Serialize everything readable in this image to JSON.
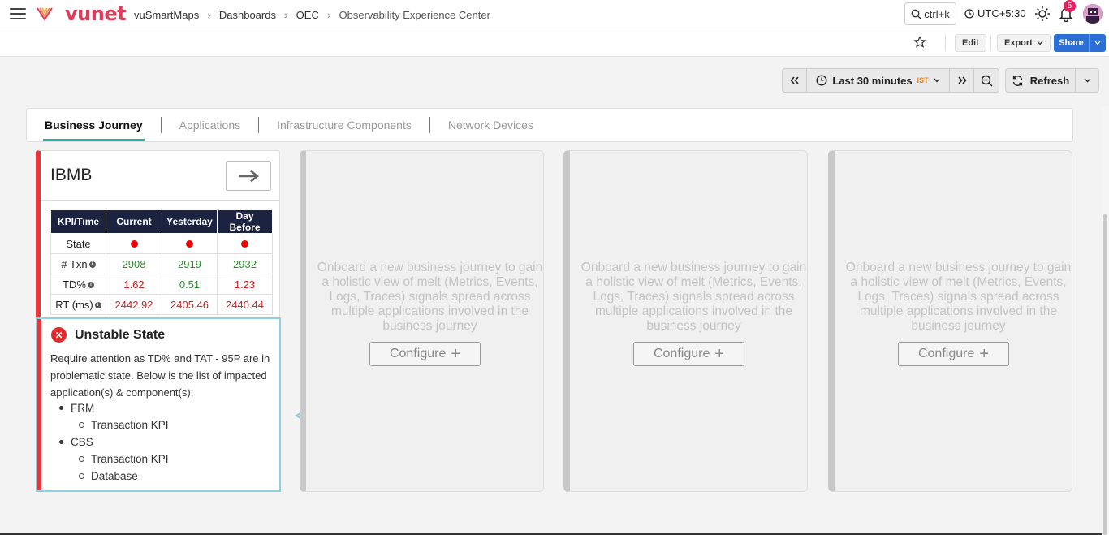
{
  "topbar": {
    "logo": "vunet",
    "breadcrumb": [
      "vuSmartMaps",
      "Dashboards",
      "OEC",
      "Observability Experience Center"
    ],
    "search_label": "ctrl+k",
    "timezone": "UTC+5:30",
    "notification_count": "5"
  },
  "actions": {
    "edit": "Edit",
    "export": "Export",
    "share": "Share"
  },
  "timepicker": {
    "range": "Last 30 minutes",
    "tz_badge": "IST",
    "refresh": "Refresh"
  },
  "tabs": [
    "Business Journey",
    "Applications",
    "Infrastructure Components",
    "Network Devices"
  ],
  "journey": {
    "title": "IBMB",
    "table": {
      "headers": [
        "KPI/Time",
        "Current",
        "Yesterday",
        "Day Before"
      ],
      "rows": [
        {
          "kpi": "State",
          "values": [
            "",
            "",
            ""
          ]
        },
        {
          "kpi": "# Txn",
          "values": [
            "2908",
            "2919",
            "2932"
          ]
        },
        {
          "kpi": "TD%",
          "values": [
            "1.62",
            "0.51",
            "1.23"
          ]
        },
        {
          "kpi": "RT (ms)",
          "values": [
            "2442.92",
            "2405.46",
            "2440.44"
          ]
        }
      ]
    }
  },
  "status": {
    "title": "Unstable State",
    "description": "Require attention as TD% and TAT - 95P are in problematic state. Below is the list of impacted application(s) & component(s):",
    "apps": [
      {
        "name": "FRM",
        "components": [
          "Transaction KPI"
        ]
      },
      {
        "name": "CBS",
        "components": [
          "Transaction KPI",
          "Database"
        ]
      }
    ]
  },
  "placeholder": {
    "text": "Onboard a new business journey to gain a holistic view of melt (Metrics, Events, Logs, Traces) signals spread across multiple applications involved in the business journey",
    "configure": "Configure"
  },
  "colors": {
    "accent": "#1fb5a6",
    "alert_red": "#e8343a",
    "share_blue": "#2b6fd6",
    "table_header": "#1c2340",
    "highlight_border": "#8ecfe0"
  }
}
